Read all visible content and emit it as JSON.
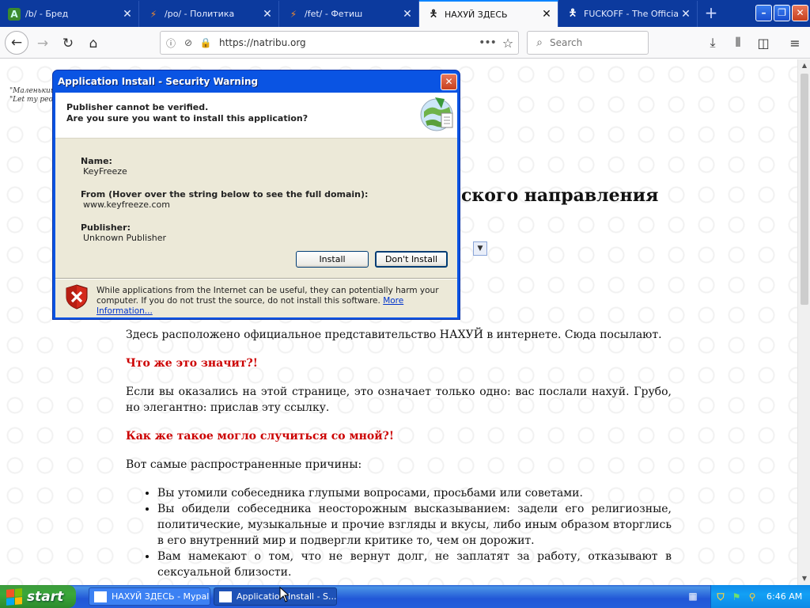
{
  "tabs": [
    {
      "title": "/b/ - Бред",
      "favicon": "2ch-icon"
    },
    {
      "title": "/po/ - Политика",
      "favicon": "lightning-icon"
    },
    {
      "title": "/fet/ - Фетиш",
      "favicon": "lightning-icon"
    },
    {
      "title": "НАХУЙ ЗДЕСЬ",
      "favicon": "man-pointing-icon",
      "active": true
    },
    {
      "title": "FUCKOFF - The Official",
      "favicon": "man-pointing-icon"
    }
  ],
  "nav": {
    "url": "https://natribu.org",
    "search_placeholder": "Search"
  },
  "page": {
    "quote_line1": "\"Маленький ш",
    "quote_line2": "\"Let my peop",
    "heading_fragment": "ского направления",
    "para1": "Здесь расположено официальное представительство НАХУЙ в интернете. Сюда посылают.",
    "q1": "Что же это значит?!",
    "para2": "Если вы оказались на этой странице, это означает только одно: вас послали нахуй. Грубо, но элегантно: прислав эту ссылку.",
    "q2": "Как же такое могло случиться со мной?!",
    "para3": "Вот самые распространенные причины:",
    "reasons": [
      "Вы утомили собеседника глупыми вопросами, просьбами или советами.",
      "Вы обидели собеседника неосторожным высказыванием: задели его религиозные, политические, музыкальные и прочие взгляды и вкусы, либо иным образом вторглись в его внутренний мир и подвергли критике то, чем он дорожит.",
      "Вам намекают о том, что не вернут долг, не заплатят за работу, отказывают в сексуальной близости."
    ]
  },
  "dialog": {
    "title": "Application Install - Security Warning",
    "head1": "Publisher cannot be verified.",
    "head2": "Are you sure you want to install this application?",
    "name_label": "Name:",
    "name_value": "KeyFreeze",
    "from_label": "From (Hover over the string below to see the full domain):",
    "from_value": "www.keyfreeze.com",
    "publisher_label": "Publisher:",
    "publisher_value": "Unknown Publisher",
    "install_button": "Install",
    "dont_install_button": "Don't Install",
    "warning_text": "While applications from the Internet can be useful, they can potentially harm your computer. If you do not trust the source, do not install this software.",
    "more_info_link": "More Information..."
  },
  "taskbar": {
    "start_label": "start",
    "task1": "НАХУЙ ЗДЕСЬ - Mypal",
    "task2": "Application Install - S...",
    "clock": "6:46 AM"
  }
}
